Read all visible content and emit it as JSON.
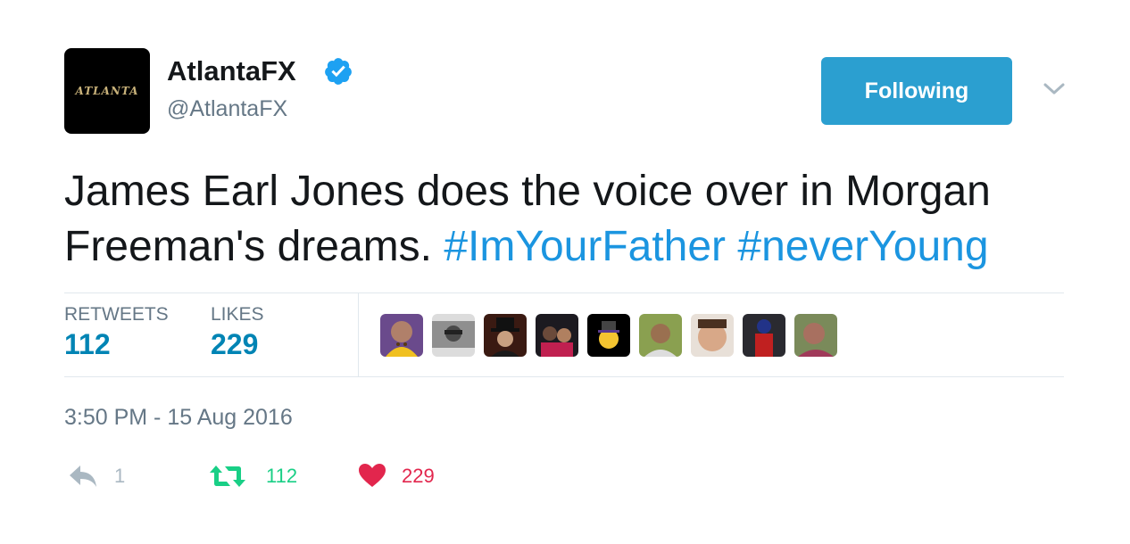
{
  "user": {
    "avatar_text": "ATLANTA",
    "display_name": "AtlantaFX",
    "handle": "@AtlantaFX",
    "verified": true
  },
  "follow_button": {
    "label": "Following",
    "color": "#2b9fd0"
  },
  "menu": {
    "icon": "chevron-down-icon"
  },
  "tweet": {
    "text_line1": "James Earl Jones does the voice over in Morgan",
    "text_line2": "Freeman's dreams.",
    "hashtags": [
      "#ImYourFather",
      "#neverYoung"
    ]
  },
  "stats": {
    "retweets_label": "RETWEETS",
    "retweets_value": "112",
    "likes_label": "LIKES",
    "likes_value": "229"
  },
  "liked_by_avatars": [
    {
      "name": "liker-avatar-1"
    },
    {
      "name": "liker-avatar-2"
    },
    {
      "name": "liker-avatar-3"
    },
    {
      "name": "liker-avatar-4"
    },
    {
      "name": "liker-avatar-5"
    },
    {
      "name": "liker-avatar-6"
    },
    {
      "name": "liker-avatar-7"
    },
    {
      "name": "liker-avatar-8"
    },
    {
      "name": "liker-avatar-9"
    }
  ],
  "timestamp": "3:50 PM - 15 Aug 2016",
  "actions": {
    "reply_count": "1",
    "retweet_count": "112",
    "like_count": "229",
    "reply_color": "#aab8c2",
    "retweet_color": "#19cf86",
    "like_color": "#e2264d"
  }
}
